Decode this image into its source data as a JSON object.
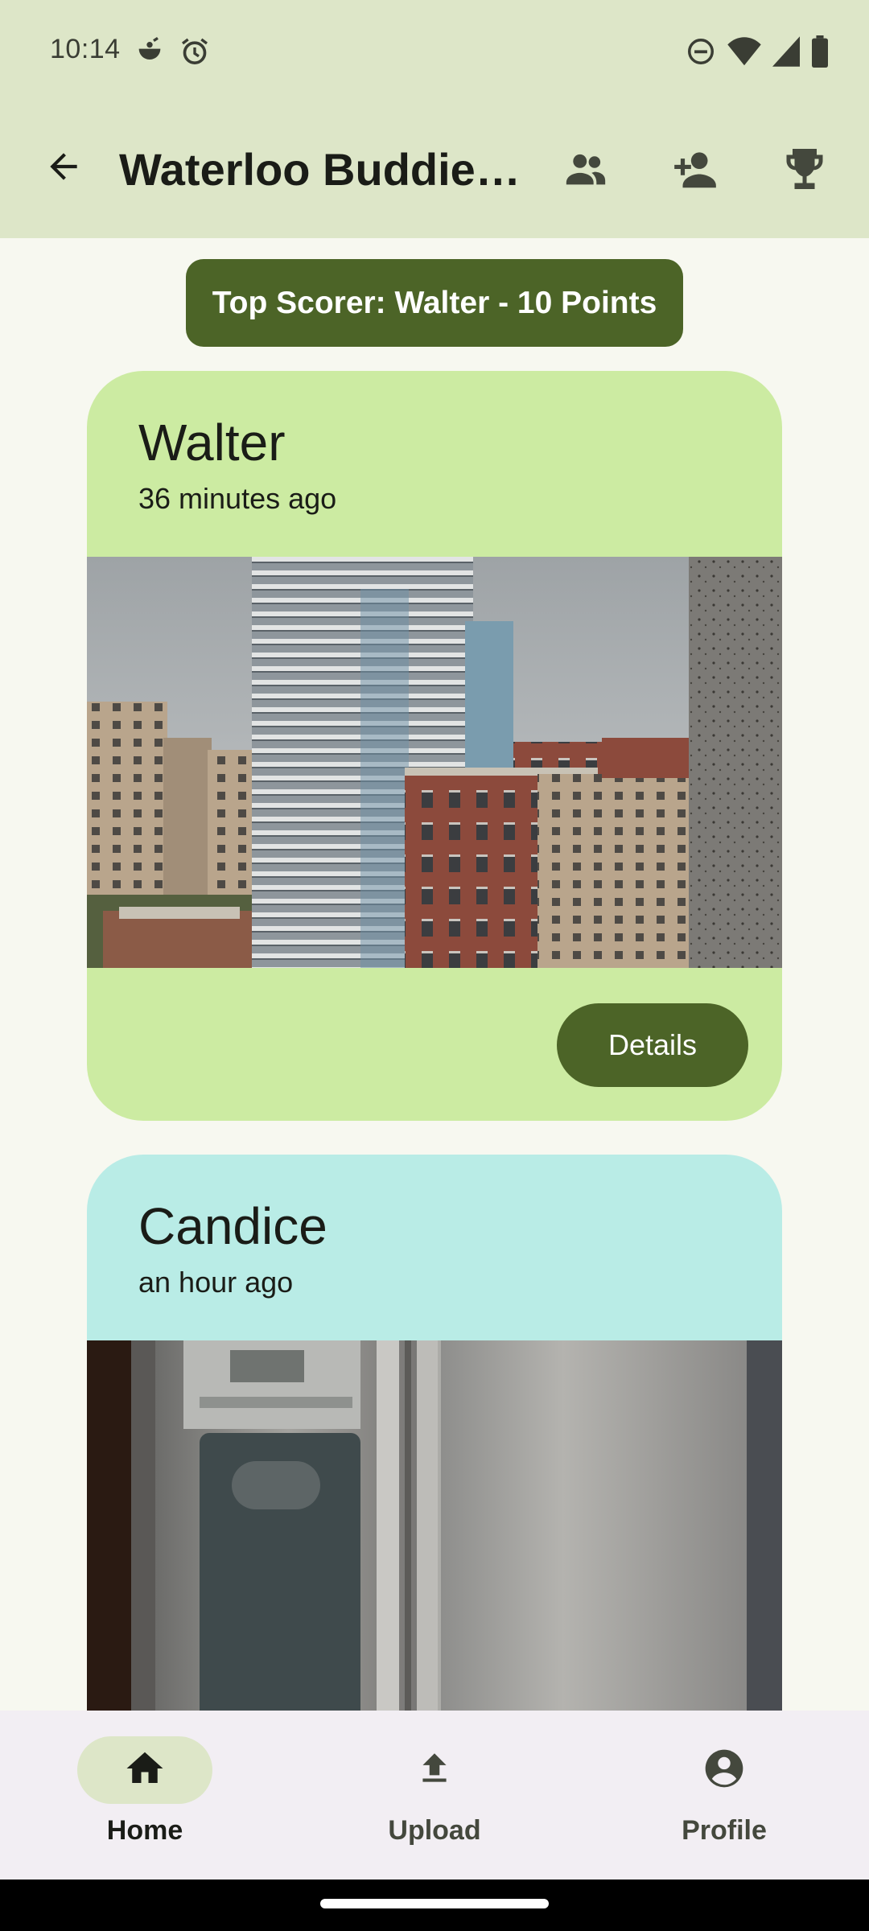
{
  "status_bar": {
    "time": "10:14",
    "left_icons": [
      "notification-icon",
      "alarm-icon"
    ],
    "right_icons": [
      "do-not-disturb-icon",
      "wifi-icon",
      "cellular-signal-icon",
      "battery-icon"
    ]
  },
  "app_bar": {
    "title": "Waterloo Buddies…",
    "actions": [
      "group-icon",
      "person-add-icon",
      "trophy-icon"
    ]
  },
  "top_scorer": {
    "text": "Top Scorer: Walter - 10 Points"
  },
  "posts": [
    {
      "name": "Walter",
      "time": "36 minutes ago",
      "photo": "city-buildings-photo",
      "details_label": "Details",
      "color": "#CCEBA2"
    },
    {
      "name": "Candice",
      "time": "an hour ago",
      "photo": "refrigerator-photo",
      "color": "#B9ECE6"
    }
  ],
  "bottom_nav": {
    "items": [
      {
        "label": "Home",
        "icon": "home-icon",
        "active": true
      },
      {
        "label": "Upload",
        "icon": "upload-icon",
        "active": false
      },
      {
        "label": "Profile",
        "icon": "account-circle-icon",
        "active": false
      }
    ]
  },
  "colors": {
    "header": "#DDE6C8",
    "primary": "#4C6427",
    "background": "#F7F8F0",
    "nav_background": "#F2EEF3"
  }
}
